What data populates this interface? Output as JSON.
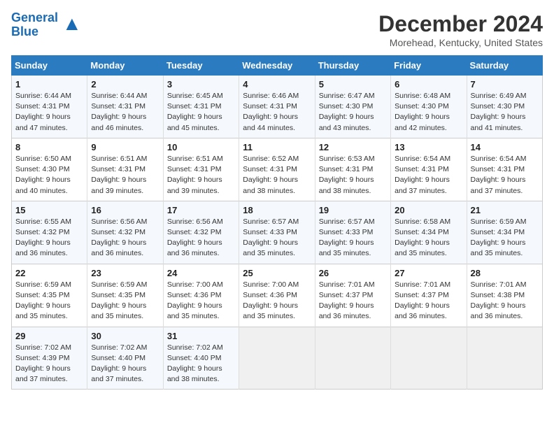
{
  "logo": {
    "line1": "General",
    "line2": "Blue"
  },
  "title": "December 2024",
  "subtitle": "Morehead, Kentucky, United States",
  "headers": [
    "Sunday",
    "Monday",
    "Tuesday",
    "Wednesday",
    "Thursday",
    "Friday",
    "Saturday"
  ],
  "weeks": [
    [
      {
        "day": "1",
        "info": "Sunrise: 6:44 AM\nSunset: 4:31 PM\nDaylight: 9 hours\nand 47 minutes."
      },
      {
        "day": "2",
        "info": "Sunrise: 6:44 AM\nSunset: 4:31 PM\nDaylight: 9 hours\nand 46 minutes."
      },
      {
        "day": "3",
        "info": "Sunrise: 6:45 AM\nSunset: 4:31 PM\nDaylight: 9 hours\nand 45 minutes."
      },
      {
        "day": "4",
        "info": "Sunrise: 6:46 AM\nSunset: 4:31 PM\nDaylight: 9 hours\nand 44 minutes."
      },
      {
        "day": "5",
        "info": "Sunrise: 6:47 AM\nSunset: 4:30 PM\nDaylight: 9 hours\nand 43 minutes."
      },
      {
        "day": "6",
        "info": "Sunrise: 6:48 AM\nSunset: 4:30 PM\nDaylight: 9 hours\nand 42 minutes."
      },
      {
        "day": "7",
        "info": "Sunrise: 6:49 AM\nSunset: 4:30 PM\nDaylight: 9 hours\nand 41 minutes."
      }
    ],
    [
      {
        "day": "8",
        "info": "Sunrise: 6:50 AM\nSunset: 4:30 PM\nDaylight: 9 hours\nand 40 minutes."
      },
      {
        "day": "9",
        "info": "Sunrise: 6:51 AM\nSunset: 4:31 PM\nDaylight: 9 hours\nand 39 minutes."
      },
      {
        "day": "10",
        "info": "Sunrise: 6:51 AM\nSunset: 4:31 PM\nDaylight: 9 hours\nand 39 minutes."
      },
      {
        "day": "11",
        "info": "Sunrise: 6:52 AM\nSunset: 4:31 PM\nDaylight: 9 hours\nand 38 minutes."
      },
      {
        "day": "12",
        "info": "Sunrise: 6:53 AM\nSunset: 4:31 PM\nDaylight: 9 hours\nand 38 minutes."
      },
      {
        "day": "13",
        "info": "Sunrise: 6:54 AM\nSunset: 4:31 PM\nDaylight: 9 hours\nand 37 minutes."
      },
      {
        "day": "14",
        "info": "Sunrise: 6:54 AM\nSunset: 4:31 PM\nDaylight: 9 hours\nand 37 minutes."
      }
    ],
    [
      {
        "day": "15",
        "info": "Sunrise: 6:55 AM\nSunset: 4:32 PM\nDaylight: 9 hours\nand 36 minutes."
      },
      {
        "day": "16",
        "info": "Sunrise: 6:56 AM\nSunset: 4:32 PM\nDaylight: 9 hours\nand 36 minutes."
      },
      {
        "day": "17",
        "info": "Sunrise: 6:56 AM\nSunset: 4:32 PM\nDaylight: 9 hours\nand 36 minutes."
      },
      {
        "day": "18",
        "info": "Sunrise: 6:57 AM\nSunset: 4:33 PM\nDaylight: 9 hours\nand 35 minutes."
      },
      {
        "day": "19",
        "info": "Sunrise: 6:57 AM\nSunset: 4:33 PM\nDaylight: 9 hours\nand 35 minutes."
      },
      {
        "day": "20",
        "info": "Sunrise: 6:58 AM\nSunset: 4:34 PM\nDaylight: 9 hours\nand 35 minutes."
      },
      {
        "day": "21",
        "info": "Sunrise: 6:59 AM\nSunset: 4:34 PM\nDaylight: 9 hours\nand 35 minutes."
      }
    ],
    [
      {
        "day": "22",
        "info": "Sunrise: 6:59 AM\nSunset: 4:35 PM\nDaylight: 9 hours\nand 35 minutes."
      },
      {
        "day": "23",
        "info": "Sunrise: 6:59 AM\nSunset: 4:35 PM\nDaylight: 9 hours\nand 35 minutes."
      },
      {
        "day": "24",
        "info": "Sunrise: 7:00 AM\nSunset: 4:36 PM\nDaylight: 9 hours\nand 35 minutes."
      },
      {
        "day": "25",
        "info": "Sunrise: 7:00 AM\nSunset: 4:36 PM\nDaylight: 9 hours\nand 35 minutes."
      },
      {
        "day": "26",
        "info": "Sunrise: 7:01 AM\nSunset: 4:37 PM\nDaylight: 9 hours\nand 36 minutes."
      },
      {
        "day": "27",
        "info": "Sunrise: 7:01 AM\nSunset: 4:37 PM\nDaylight: 9 hours\nand 36 minutes."
      },
      {
        "day": "28",
        "info": "Sunrise: 7:01 AM\nSunset: 4:38 PM\nDaylight: 9 hours\nand 36 minutes."
      }
    ],
    [
      {
        "day": "29",
        "info": "Sunrise: 7:02 AM\nSunset: 4:39 PM\nDaylight: 9 hours\nand 37 minutes."
      },
      {
        "day": "30",
        "info": "Sunrise: 7:02 AM\nSunset: 4:40 PM\nDaylight: 9 hours\nand 37 minutes."
      },
      {
        "day": "31",
        "info": "Sunrise: 7:02 AM\nSunset: 4:40 PM\nDaylight: 9 hours\nand 38 minutes."
      },
      {
        "day": "",
        "info": ""
      },
      {
        "day": "",
        "info": ""
      },
      {
        "day": "",
        "info": ""
      },
      {
        "day": "",
        "info": ""
      }
    ]
  ]
}
